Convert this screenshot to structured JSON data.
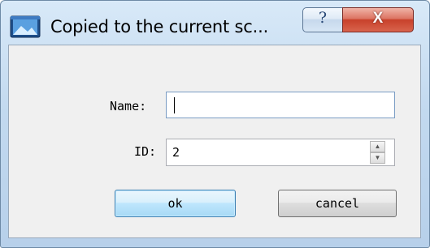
{
  "window": {
    "title": "Copied to the current sc...",
    "icon": "window-app-icon"
  },
  "titlebar_buttons": {
    "help_glyph": "?",
    "close_glyph": "X"
  },
  "form": {
    "name_label": "Name:",
    "name_value": "",
    "id_label": "ID:",
    "id_value": "2",
    "spin_up_glyph": "▲",
    "spin_down_glyph": "▼"
  },
  "buttons": {
    "ok_label": "ok",
    "cancel_label": "cancel"
  },
  "colors": {
    "title_gradient_top": "#d8e9f8",
    "close_button": "#c8412b",
    "ok_border": "#3c7fb1"
  }
}
